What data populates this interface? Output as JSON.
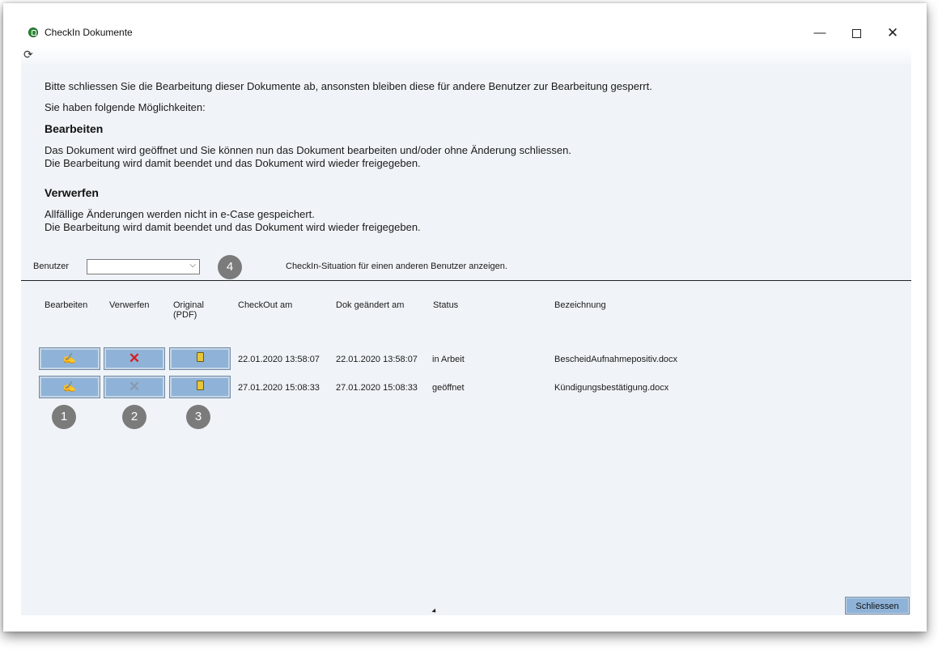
{
  "window": {
    "title": "CheckIn Dokumente",
    "minimize": "—",
    "close": "✕"
  },
  "toolbar": {
    "refresh_icon": "refresh-icon"
  },
  "intro": {
    "line1": "Bitte schliessen Sie die Bearbeitung dieser Dokumente ab, ansonsten bleiben diese für andere Benutzer zur Bearbeitung gesperrt.",
    "line2": "Sie haben folgende Möglichkeiten:"
  },
  "bearbeiten_section": {
    "heading": "Bearbeiten",
    "line1": "Das Dokument wird geöffnet und Sie können nun das Dokument bearbeiten und/oder ohne Änderung schliessen.",
    "line2": "Die Bearbeitung wird damit beendet und das Dokument wird wieder freigegeben."
  },
  "verwerfen_section": {
    "heading": "Verwerfen",
    "line1": "Allfällige Änderungen werden nicht in e-Case gespeichert.",
    "line2": "Die Bearbeitung wird damit beendet und das Dokument wird wieder freigegeben."
  },
  "user_filter": {
    "label": "Benutzer",
    "selected": "",
    "hint": "CheckIn-Situation für einen anderen Benutzer anzeigen."
  },
  "badges": {
    "b1": "1",
    "b2": "2",
    "b3": "3",
    "b4": "4"
  },
  "table": {
    "headers": {
      "bearbeiten": "Bearbeiten",
      "verwerfen": "Verwerfen",
      "original_1": "Original",
      "original_2": "(PDF)",
      "checkout": "CheckOut am",
      "changed": "Dok geändert am",
      "status": "Status",
      "name": "Bezeichnung"
    },
    "rows": [
      {
        "checkout": "22.01.2020 13:58:07",
        "changed": "22.01.2020 13:58:07",
        "status": "in Arbeit",
        "name": "BescheidAufnahmepositiv.docx",
        "verwerfen_enabled": true
      },
      {
        "checkout": "27.01.2020 15:08:33",
        "changed": "27.01.2020 15:08:33",
        "status": "geöffnet",
        "name": "Kündigungsbestätigung.docx",
        "verwerfen_enabled": false
      }
    ]
  },
  "footer": {
    "close_label": "Schliessen"
  },
  "colors": {
    "button_fill": "#8fb3d8",
    "content_bg": "#f0f4f8",
    "discard_red": "#d81e1e",
    "badge": "#7b7b7b"
  }
}
